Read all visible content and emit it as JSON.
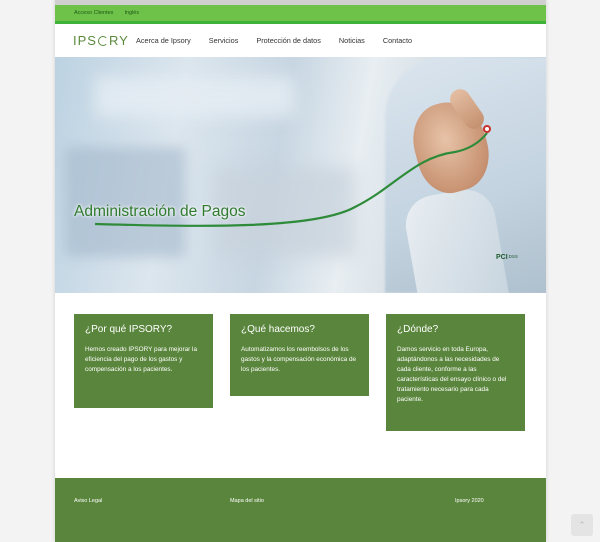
{
  "topbar": {
    "links": [
      "Acceso Clientes",
      "Inglés"
    ]
  },
  "header": {
    "logo": "IPSORY",
    "nav": [
      "Acerca de Ipsory",
      "Servicios",
      "Protección de datos",
      "Noticias",
      "Contacto"
    ]
  },
  "hero": {
    "title": "Administración de Pagos",
    "badge": {
      "pci": "PCI",
      "dss": "DSS"
    }
  },
  "cards": [
    {
      "title": "¿Por qué IPSORY?",
      "text": "Hemos creado IPSORY para mejorar la eficiencia del pago de los gastos y compensación a los pacientes."
    },
    {
      "title": "¿Qué hacemos?",
      "text": "Automatizamos los reembolsos de los gastos y la compensación económica de los pacientes."
    },
    {
      "title": "¿Dónde?",
      "text": "Damos servicio en toda Europa, adaptándonos a las necesidades de cada cliente, conforme a las características del ensayo clínico o del tratamiento necesario para cada paciente."
    }
  ],
  "footer": {
    "legal": "Aviso Legal",
    "sitemap": "Mapa del sitio",
    "copyright": "Ipsory 2020"
  },
  "scroll_top_icon": "chevron-up-icon"
}
